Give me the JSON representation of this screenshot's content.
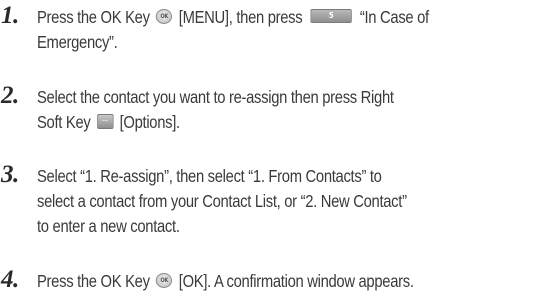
{
  "steps": [
    {
      "number": "1.",
      "lines": [
        [
          "Press the OK Key",
          "OK",
          "[MENU], then press",
          "5",
          "“In Case of"
        ],
        [
          "Emergency”."
        ]
      ]
    },
    {
      "number": "2.",
      "lines": [
        [
          "Select the contact you want to re-assign then press Right"
        ],
        [
          "Soft Key",
          "…",
          "[Options]."
        ]
      ]
    },
    {
      "number": "3.",
      "lines": [
        [
          "Select “1. Re-assign”, then select “1. From Contacts” to"
        ],
        [
          "select a contact from your Contact List, or “2. New Contact”"
        ],
        [
          "to enter a new contact."
        ]
      ]
    },
    {
      "number": "4.",
      "lines": [
        [
          "Press the OK Key",
          "OK",
          "[OK]. A confirmation window appears."
        ]
      ]
    }
  ],
  "icons": {
    "ok_key": "ok-key-icon",
    "five_key": "five-key-icon",
    "right_soft_key": "right-soft-key-icon"
  }
}
